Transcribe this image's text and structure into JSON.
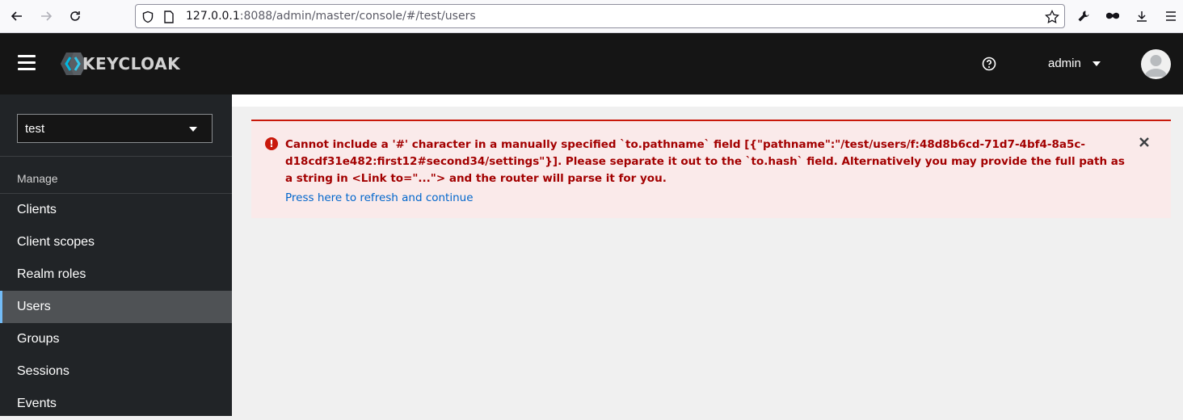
{
  "browser": {
    "url_host": "127.0.0.1",
    "url_rest": ":8088/admin/master/console/#/test/users"
  },
  "masthead": {
    "logo_text": "KEYCLOAK",
    "user_name": "admin"
  },
  "sidebar": {
    "realm": "test",
    "section_label": "Manage",
    "items": [
      {
        "label": "Clients"
      },
      {
        "label": "Client scopes"
      },
      {
        "label": "Realm roles"
      },
      {
        "label": "Users"
      },
      {
        "label": "Groups"
      },
      {
        "label": "Sessions"
      },
      {
        "label": "Events"
      }
    ]
  },
  "alert": {
    "title": "Cannot include a '#' character in a manually specified `to.pathname` field [{\"pathname\":\"/test/users/f:48d8b6cd-71d7-4bf4-8a5c-d18cdf31e482:first12#second34/settings\"}]. Please separate it out to the `to.hash` field. Alternatively you may provide the full path as a string in <Link to=\"...\"> and the router will parse it for you.",
    "link_label": "Press here to refresh and continue"
  },
  "colors": {
    "accent_blue": "#73bcf7",
    "danger": "#c9190b",
    "link": "#0066cc"
  }
}
